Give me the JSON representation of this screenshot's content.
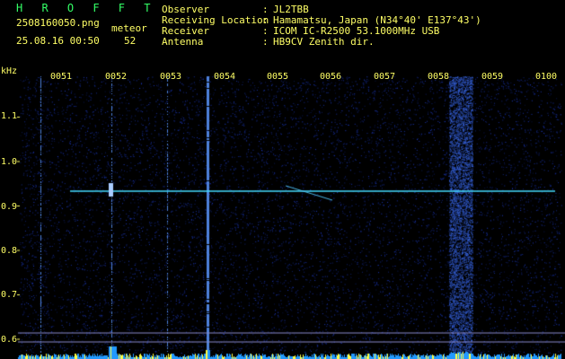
{
  "app": {
    "title": "H R O F F T"
  },
  "file": {
    "name": "2508160050.png",
    "datetime": "25.08.16 00:50"
  },
  "meteor": {
    "label": "meteor",
    "count": "52"
  },
  "info": [
    {
      "key": "Observer",
      "sep": ":",
      "value": "JL2TBB"
    },
    {
      "key": "Receiving Location",
      "sep": ":",
      "value": "Hamamatsu, Japan (N34°40' E137°43')"
    },
    {
      "key": "Receiver",
      "sep": ":",
      "value": "ICOM IC-R2500 53.1000MHz USB"
    },
    {
      "key": "Antenna",
      "sep": ":",
      "value": "HB9CV Zenith dir."
    }
  ],
  "axis": {
    "unit": "kHz",
    "x_ticks": [
      "0051",
      "0052",
      "0053",
      "0054",
      "0055",
      "0056",
      "0057",
      "0058",
      "0059",
      "0100"
    ],
    "y_ticks": [
      "1.1",
      "1.0",
      "0.9",
      "0.8",
      "0.7",
      "0.6"
    ]
  },
  "colors": {
    "label": "#ffff66",
    "title": "#33ff66",
    "trace": "#44ddff",
    "noise": "#1030a0"
  }
}
